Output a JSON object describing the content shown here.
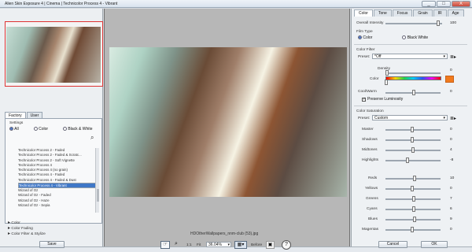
{
  "window": {
    "title": "Alien Skin Exposure 4 | Cinema | Technicolor Process 4 - Vibrant",
    "btn_min": "_",
    "btn_max": "□",
    "btn_close": "X"
  },
  "left": {
    "tabs": [
      "Factory",
      "User"
    ],
    "settings_label": "Settings",
    "radio": [
      "All",
      "Color",
      "Black & White"
    ],
    "presets": [
      "Technicolor Process 2 - Faded",
      "Technicolor Process 2 - Faded & Scratc...",
      "Technicolor Process 2 - Soft Vignette",
      "Technicolor Process 4",
      "Technicolor Process 4 (no grain)",
      "Technicolor Process 4 - Faded",
      "Technicolor Process 4 - Faded & Dust",
      "Technicolor Process 4 - Vibrant",
      "Wizard of Oz",
      "Wizard of Oz - Faded",
      "Wizard of Oz - Haze",
      "Wizard of Oz - Sepia"
    ],
    "selected_index": 7,
    "categories": [
      "Color",
      "Color Fading",
      "Color Filter & Stylize"
    ]
  },
  "center": {
    "filename": "HDOtherWallpapers_nnm-club (53).jpg"
  },
  "right": {
    "tabs": [
      "Color",
      "Tone",
      "Focus",
      "Grain",
      "IR",
      "Age"
    ],
    "overall_intensity_label": "Overall Intensity",
    "overall_intensity": "100",
    "film_type_label": "Film Type",
    "film_color": "Color",
    "film_bw": "Black White",
    "color_filter_label": "Color Filter",
    "preset_label": "Preset:",
    "preset_value": "*Off",
    "density_label": "Density",
    "density": "0",
    "color_label": "Color",
    "coolwarm_label": "Cool/Warm",
    "coolwarm": "0",
    "preserve_label": "Preserve Luminosity",
    "color_sat_label": "Color Saturation",
    "preset2_label": "Preset:",
    "preset2_value": "Custom",
    "sat": [
      {
        "label": "Master",
        "value": "0"
      },
      {
        "label": "Shadows",
        "value": "0"
      },
      {
        "label": "Midtones",
        "value": "4"
      },
      {
        "label": "Highlights",
        "value": "-8"
      }
    ],
    "hues": [
      {
        "label": "Reds",
        "value": "10"
      },
      {
        "label": "Yellows",
        "value": "0"
      },
      {
        "label": "Greens",
        "value": "7"
      },
      {
        "label": "Cyans",
        "value": "6"
      },
      {
        "label": "Blues",
        "value": "9"
      },
      {
        "label": "Magentas",
        "value": "0"
      }
    ],
    "cancel": "Cancel",
    "ok": "OK"
  },
  "bottom": {
    "save": "Save",
    "zoom_1_1": "1:1",
    "fit": "Fit",
    "zoom": "36.04%",
    "before": "Before"
  },
  "colors": {
    "selected": "#3f77c7",
    "orange": "#f17a1d"
  }
}
